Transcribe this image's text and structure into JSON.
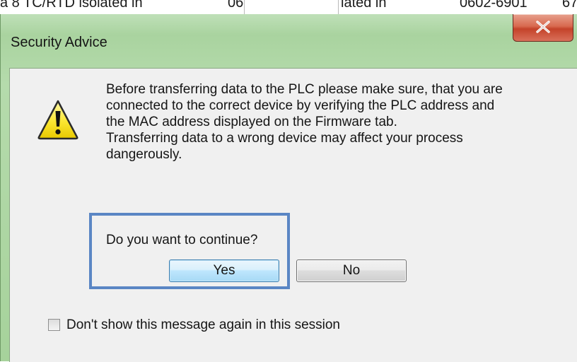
{
  "background_table": {
    "cells": [
      "a 8 TC/RTD isolated in",
      "06",
      "lated in",
      "0602-6901",
      "67"
    ]
  },
  "dialog": {
    "title": "Security Advice",
    "close_icon": "close-icon",
    "warning_icon": "warning-icon",
    "message_lines": [
      "Before transferring data to the PLC please make sure, that you are",
      "connected to the correct device by verifying the PLC address and",
      "the MAC address displayed on the Firmware tab.",
      "Transferring data to a wrong device may affect your process",
      "dangerously."
    ],
    "question": "Do you want to continue?",
    "yes_label": "Yes",
    "no_label": "No",
    "checkbox_label": "Don't show this message again in this session",
    "checkbox_checked": false
  },
  "colors": {
    "frame": "#a9d39f",
    "close_button": "#c4432a",
    "highlight": "#5a86c4",
    "default_button": "#a7d9f5"
  }
}
